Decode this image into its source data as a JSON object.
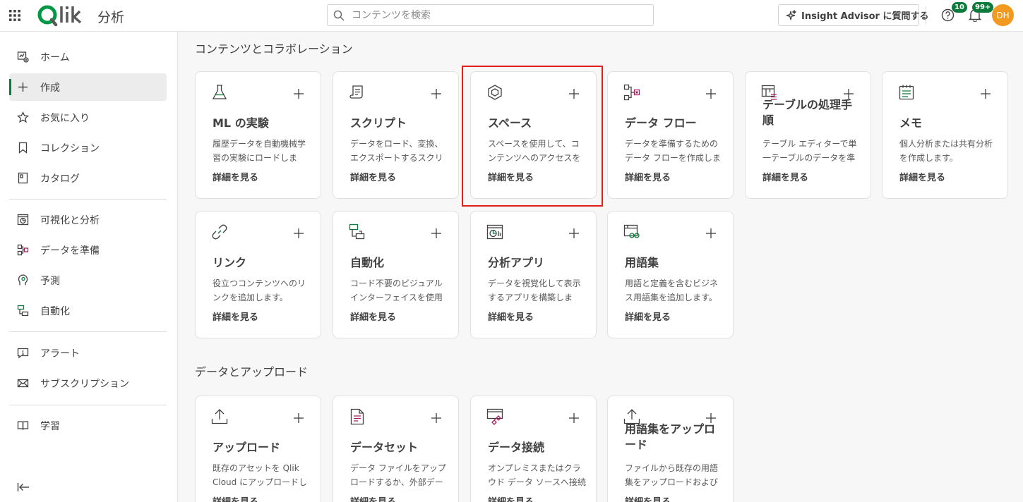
{
  "header": {
    "logo": "Qlik",
    "title": "分析",
    "search_placeholder": "コンテンツを検索",
    "advisor_label": "Insight Advisor に質問する",
    "help_badge": "10",
    "notif_badge": "99+",
    "avatar_initials": "DH"
  },
  "sidebar": {
    "items": [
      {
        "label": "ホーム",
        "icon": "home-icon"
      },
      {
        "label": "作成",
        "icon": "plus-icon",
        "active": true
      },
      {
        "label": "お気に入り",
        "icon": "star-icon"
      },
      {
        "label": "コレクション",
        "icon": "bookmark-icon"
      },
      {
        "label": "カタログ",
        "icon": "catalog-icon"
      },
      {
        "label": "可視化と分析",
        "icon": "analytics-icon"
      },
      {
        "label": "データを準備",
        "icon": "data-prep-icon"
      },
      {
        "label": "予測",
        "icon": "predict-icon"
      },
      {
        "label": "自動化",
        "icon": "automation-icon"
      },
      {
        "label": "アラート",
        "icon": "alert-icon"
      },
      {
        "label": "サブスクリプション",
        "icon": "mail-icon"
      },
      {
        "label": "学習",
        "icon": "book-icon"
      }
    ]
  },
  "sections": [
    {
      "title": "コンテンツとコラボレーション"
    },
    {
      "title": "データとアップロード"
    }
  ],
  "cards": [
    {
      "title": "ML の実験",
      "desc": "履歴データを自動機械学習の実験にロードします。",
      "link": "詳細を見る",
      "icon": "flask-icon"
    },
    {
      "title": "スクリプト",
      "desc": "データをロード、変換、エクスポートするスクリプトを作成します。",
      "link": "詳細を見る",
      "icon": "script-icon"
    },
    {
      "title": "スペース",
      "desc": "スペースを使用して、コンテンツへのアクセスを管理します。",
      "link": "詳細を見る",
      "icon": "space-icon"
    },
    {
      "title": "データ フロー",
      "desc": "データを準備するためのデータ フローを作成します。",
      "link": "詳細を見る",
      "icon": "data-flow-icon"
    },
    {
      "title": "テーブルの処理手順",
      "desc": "テーブル エディターで単一テーブルのデータを準備します。",
      "link": "詳細を見る",
      "icon": "table-recipe-icon"
    },
    {
      "title": "メモ",
      "desc": "個人分析または共有分析を作成します。",
      "link": "詳細を見る",
      "icon": "note-icon"
    },
    {
      "title": "リンク",
      "desc": "役立つコンテンツへのリンクを追加します。",
      "link": "詳細を見る",
      "icon": "link-icon"
    },
    {
      "title": "自動化",
      "desc": "コード不要のビジュアルインターフェイスを使用します。",
      "link": "詳細を見る",
      "icon": "automation-icon"
    },
    {
      "title": "分析アプリ",
      "desc": "データを視覚化して表示するアプリを構築します。",
      "link": "詳細を見る",
      "icon": "analytics-app-icon"
    },
    {
      "title": "用語集",
      "desc": "用語と定義を含むビジネス用語集を追加します。",
      "link": "詳細を見る",
      "icon": "glossary-icon"
    },
    {
      "title": "アップロード",
      "desc": "既存のアセットを Qlik Cloud にアップロードします。",
      "link": "詳細を見る",
      "icon": "upload-icon"
    },
    {
      "title": "データセット",
      "desc": "データ ファイルをアップロードするか、外部データを追加します。",
      "link": "詳細を見る",
      "icon": "dataset-icon"
    },
    {
      "title": "データ接続",
      "desc": "オンプレミスまたはクラウド データ ソースへ接続します。",
      "link": "詳細を見る",
      "icon": "data-connection-icon"
    },
    {
      "title": "用語集をアップロード",
      "desc": "ファイルから既存の用語集をアップロードおよびインポートします。",
      "link": "詳細を見る",
      "icon": "upload-glossary-icon"
    }
  ],
  "colors": {
    "brand_green": "#009845",
    "highlight_red": "#e0201b",
    "avatar_orange": "#f29a1f"
  }
}
